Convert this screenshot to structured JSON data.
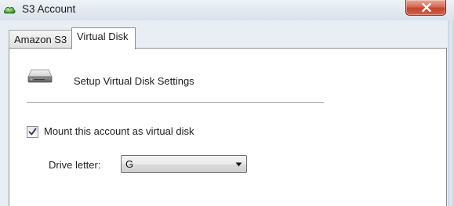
{
  "window": {
    "title": "S3 Account",
    "icon": "green-cloud-icon",
    "close_icon": "close-icon"
  },
  "tabs": [
    {
      "label": "Amazon S3",
      "active": false
    },
    {
      "label": "Virtual Disk",
      "active": true
    }
  ],
  "virtual_disk": {
    "header_icon": "hard-drive-icon",
    "section_title": "Setup Virtual Disk Settings",
    "mount_checkbox": {
      "label": "Mount this account as virtual disk",
      "checked": true
    },
    "drive_letter": {
      "label": "Drive letter:",
      "value": "G",
      "icon": "chevron-down-icon"
    }
  },
  "colors": {
    "close_button": "#c94d35",
    "panel_background": "#ffffff",
    "frame": "#e9eef5"
  }
}
